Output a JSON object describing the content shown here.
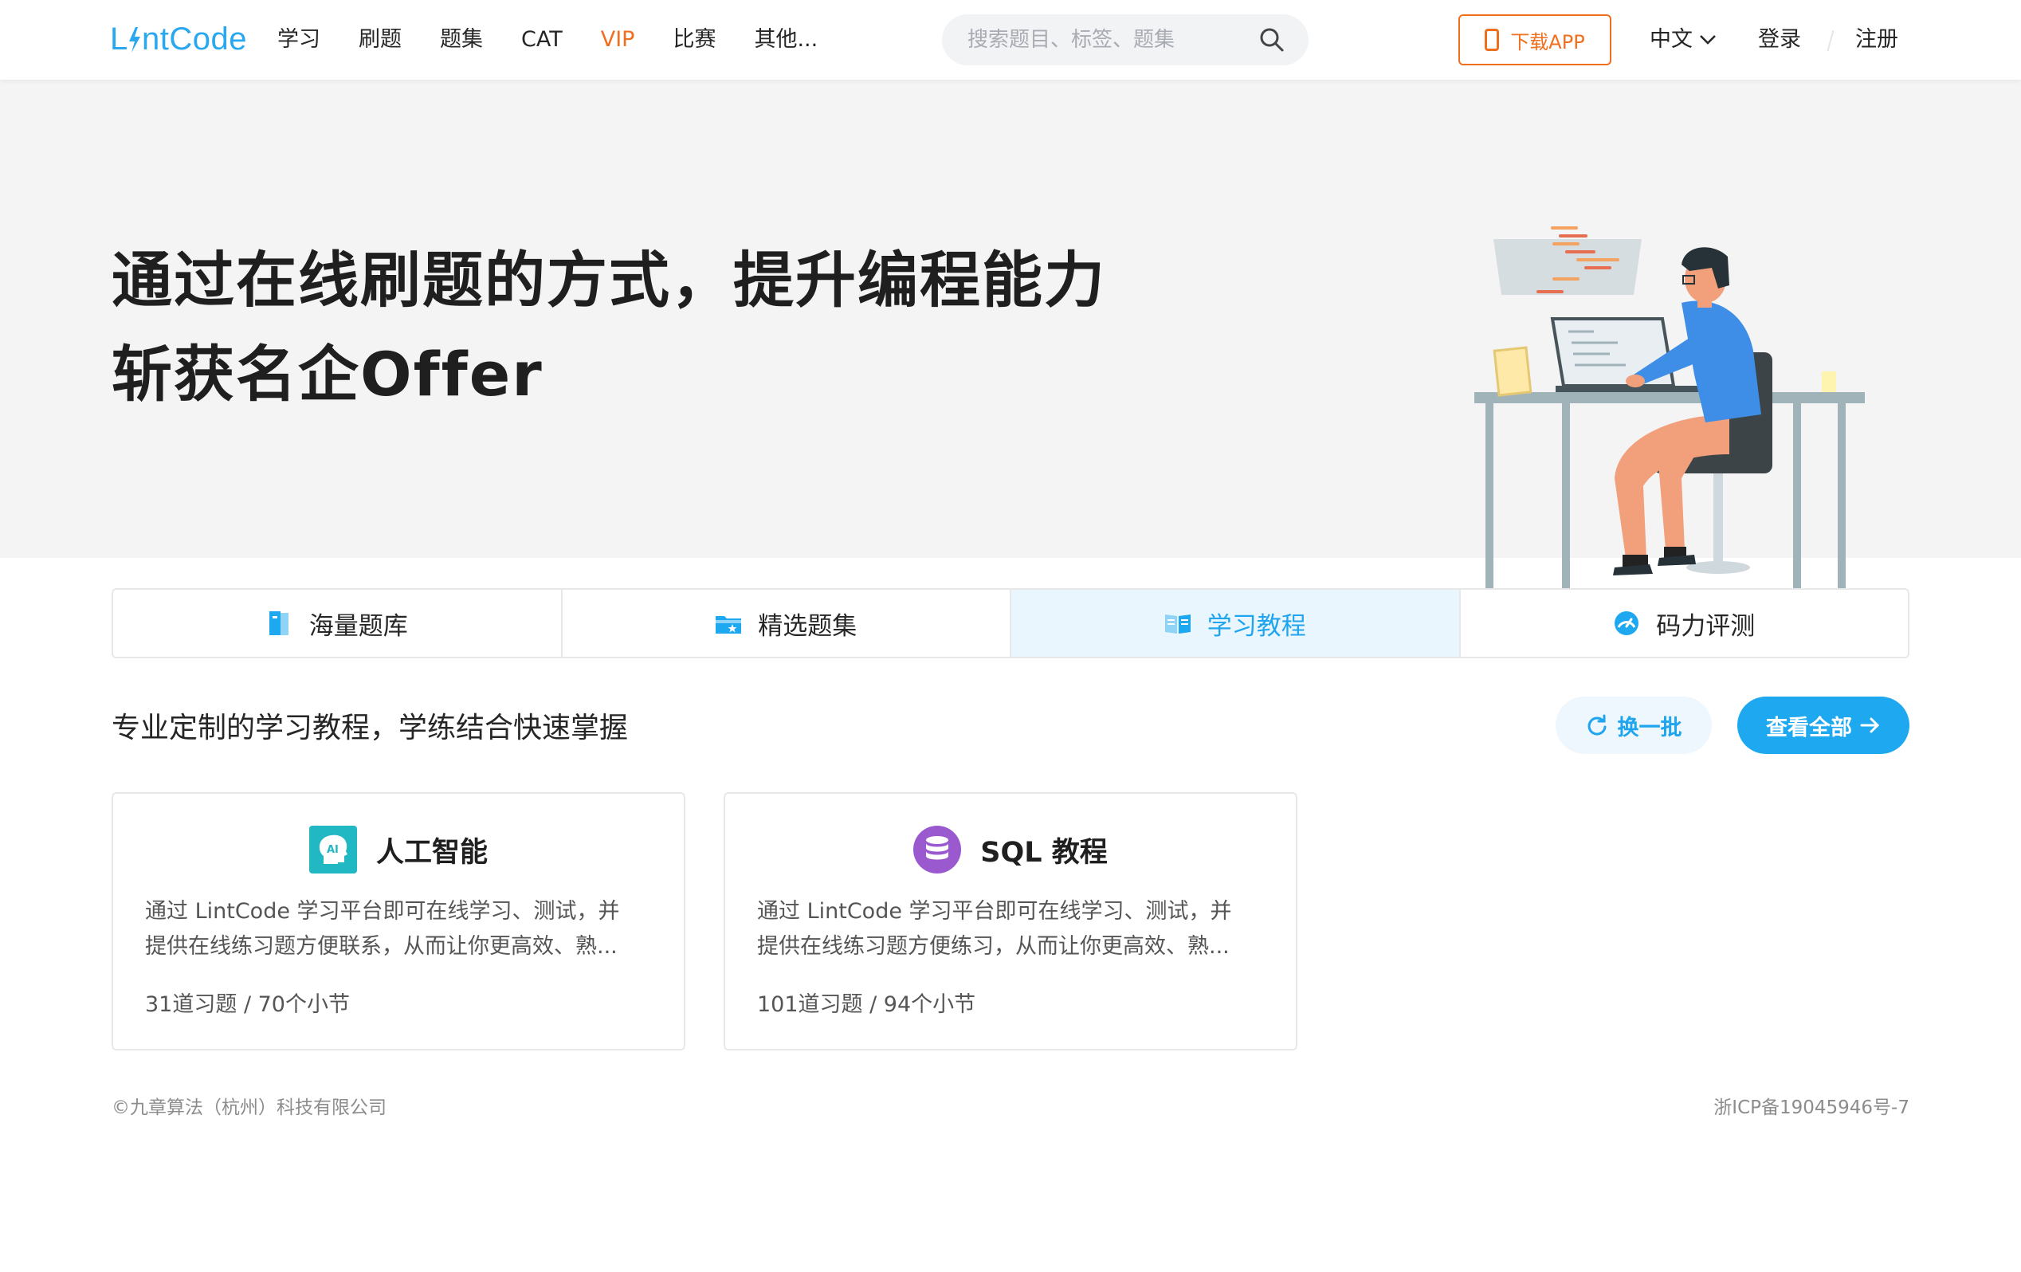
{
  "header": {
    "logo": "LintCode",
    "nav": [
      "学习",
      "刷题",
      "题集",
      "CAT",
      "VIP",
      "比赛",
      "其他..."
    ],
    "search_placeholder": "搜索题目、标签、题集",
    "download_label": "下载APP",
    "language": "中文",
    "login": "登录",
    "register": "注册"
  },
  "hero": {
    "line1": "通过在线刷题的方式，提升编程能力",
    "line2": "斩获名企Offer"
  },
  "tabs": [
    {
      "label": "海量题库",
      "icon": "book-icon",
      "active": false
    },
    {
      "label": "精选题集",
      "icon": "folder-star-icon",
      "active": false
    },
    {
      "label": "学习教程",
      "icon": "open-book-icon",
      "active": true
    },
    {
      "label": "码力评测",
      "icon": "gauge-icon",
      "active": false
    }
  ],
  "section": {
    "title": "专业定制的学习教程，学练结合快速掌握",
    "refresh_label": "换一批",
    "viewall_label": "查看全部"
  },
  "cards": [
    {
      "title": "人工智能",
      "icon": "ai-head-icon",
      "desc_line1": "通过 LintCode 学习平台即可在线学习、测试，并",
      "desc_line2": "提供在线练习题方便联系，从而让你更高效、熟...",
      "meta": "31道习题 / 70个小节"
    },
    {
      "title": "SQL 教程",
      "icon": "database-icon",
      "desc_line1": "通过 LintCode 学习平台即可在线学习、测试，并",
      "desc_line2": "提供在线练习题方便练习，从而让你更高效、熟...",
      "meta": "101道习题 / 94个小节"
    }
  ],
  "footer": {
    "left": "©九章算法（杭州）科技有限公司",
    "right": "浙ICP备19045946号-7"
  },
  "colors": {
    "brand_blue": "#1ea8ef",
    "vip_orange": "#f06f1e"
  }
}
